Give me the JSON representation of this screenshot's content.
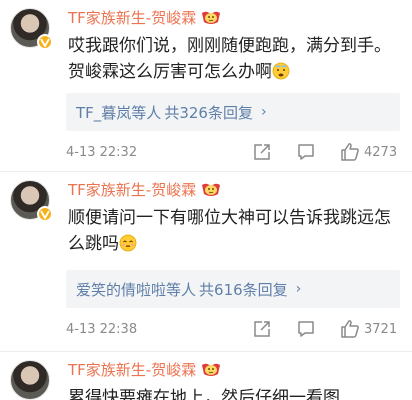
{
  "comments": [
    {
      "user": "TF家族新生-贺峻霖",
      "text": "哎我跟你们说，刚刚随便跑跑，满分到手。贺峻霖这么厉害可怎么办啊",
      "reply": {
        "users": "TF_暮岚",
        "suffix": "等人",
        "count": "共326条回复"
      },
      "time": "4-13 22:32",
      "likes": "4273"
    },
    {
      "user": "TF家族新生-贺峻霖",
      "text": "顺便请问一下有哪位大神可以告诉我跳远怎么跳吗",
      "reply": {
        "users": "爱笑的倩啦啦",
        "suffix": "等人",
        "count": "共616条回复"
      },
      "time": "4-13 22:38",
      "likes": "3721"
    },
    {
      "user": "TF家族新生-贺峻霖",
      "text": "累得快要瘫在地上，然后仔细一看图"
    }
  ],
  "colors": {
    "name": "#eb7350",
    "link": "#5f7fa8",
    "meta": "#8a8a8a",
    "reply_bg": "#f3f4f6"
  }
}
